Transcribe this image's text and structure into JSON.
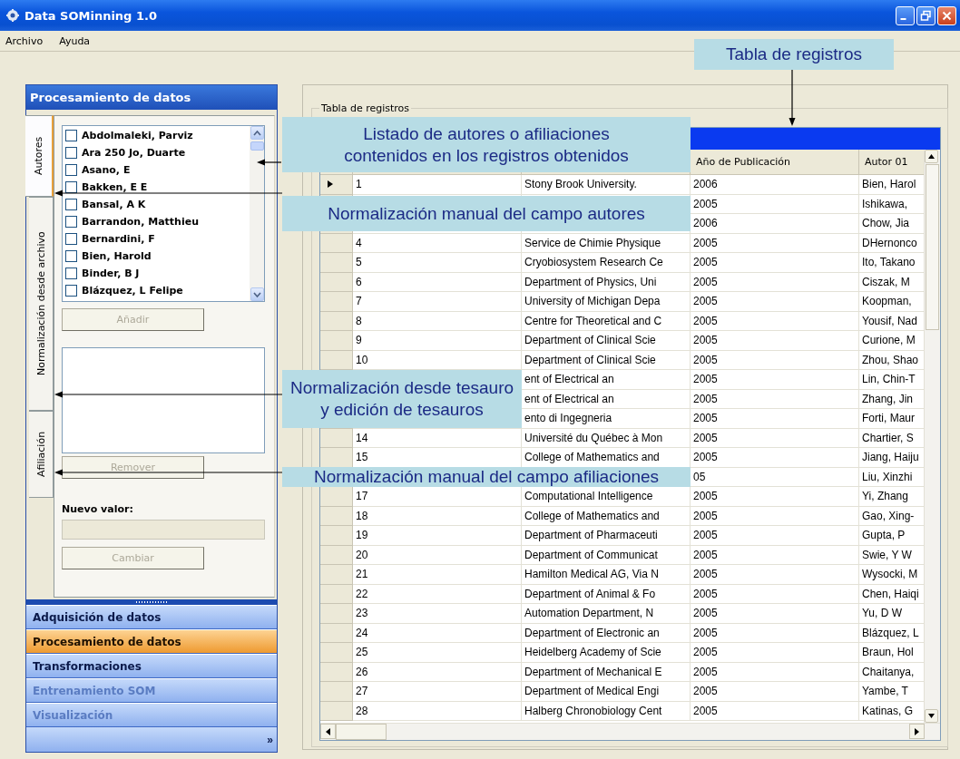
{
  "window": {
    "title": "Data SOMinning 1.0"
  },
  "menu": [
    "Archivo",
    "Ayuda"
  ],
  "left_panel": {
    "title": "Procesamiento de datos",
    "tabs": [
      {
        "label": "Autores",
        "selected": true
      },
      {
        "label": "Normalización desde archivo",
        "selected": false
      },
      {
        "label": "Afiliación",
        "selected": false
      }
    ],
    "list": [
      {
        "label": "Abdolmaleki, Parviz",
        "checked": false
      },
      {
        "label": "Ara 250 Jo, Duarte",
        "checked": false
      },
      {
        "label": "Asano, E",
        "checked": false
      },
      {
        "label": "Bakken, E E",
        "checked": false
      },
      {
        "label": "Bansal, A K",
        "checked": false
      },
      {
        "label": "Barrandon, Matthieu",
        "checked": false
      },
      {
        "label": "Bernardini, F",
        "checked": false
      },
      {
        "label": "Bien, Harold",
        "checked": false
      },
      {
        "label": "Binder, B J",
        "checked": false
      },
      {
        "label": "Blázquez, L Felipe",
        "checked": false
      }
    ],
    "add_button": {
      "label": "Añadir",
      "disabled": true
    },
    "remove_button": {
      "label": "Remover",
      "disabled": true
    },
    "new_value_label": "Nuevo valor:",
    "new_value_field": {
      "disabled": true
    },
    "change_button": {
      "label": "Cambiar",
      "disabled": true
    }
  },
  "nav": [
    {
      "label": "Adquisición de datos",
      "selected": false,
      "disabled": false
    },
    {
      "label": "Procesamiento de datos",
      "selected": true,
      "disabled": false
    },
    {
      "label": "Transformaciones",
      "selected": false,
      "disabled": false
    },
    {
      "label": "Entrenamiento SOM",
      "selected": false,
      "disabled": true
    },
    {
      "label": "Visualización",
      "selected": false,
      "disabled": true
    }
  ],
  "nav_more": "»",
  "records": {
    "legend": "Tabla de registros",
    "headers": {
      "year": "Año de Publicación",
      "author": "Autor 01"
    },
    "rows": [
      {
        "number": "1",
        "affiliation": "Stony Brook University.",
        "year": "2006",
        "author": "Bien, Harol",
        "current": true
      },
      {
        "year": "2005",
        "author": "Ishikawa,"
      },
      {
        "year": "2006",
        "author": "Chow, Jia"
      },
      {
        "number": "4",
        "affiliation": "Service de Chimie Physique",
        "year": "2005",
        "author": "DHernonco",
        "current": false
      },
      {
        "number": "5",
        "affiliation": "Cryobiosystem Research Ce",
        "year": "2005",
        "author": "Ito, Takano",
        "current": false
      },
      {
        "number": "6",
        "affiliation": "Department of Physics, Uni",
        "year": "2005",
        "author": "Ciszak, M",
        "current": false
      },
      {
        "number": "7",
        "affiliation": "University of Michigan Depa",
        "year": "2005",
        "author": "Koopman,",
        "current": false
      },
      {
        "number": "8",
        "affiliation": "Centre for Theoretical and C",
        "year": "2005",
        "author": "Yousif, Nad",
        "current": false
      },
      {
        "number": "9",
        "affiliation": "Department of Clinical Scie",
        "year": "2005",
        "author": "Curione, M",
        "current": false
      },
      {
        "number": "10",
        "affiliation": "Department of Clinical Scie",
        "year": "2005",
        "author": "Zhou, Shao",
        "current": false
      },
      {
        "affiliation": "ent of Electrical an",
        "year": "2005",
        "author": "Lin, Chin-T"
      },
      {
        "affiliation": "ent of Electrical an",
        "year": "2005",
        "author": "Zhang, Jin"
      },
      {
        "affiliation": "ento di Ingegneria",
        "year": "2005",
        "author": "Forti, Maur"
      },
      {
        "number": "14",
        "affiliation": "Université du Québec à Mon",
        "year": "2005",
        "author": "Chartier, S",
        "current": false
      },
      {
        "number": "15",
        "affiliation": "College of Mathematics and",
        "year": "2005",
        "author": "Jiang, Haiju",
        "current": false
      },
      {
        "year": "05",
        "author": "Liu, Xinzhi"
      },
      {
        "number": "17",
        "affiliation": "Computational Intelligence",
        "year": "2005",
        "author": "Yi, Zhang",
        "current": false
      },
      {
        "number": "18",
        "affiliation": "College of Mathematics and",
        "year": "2005",
        "author": "Gao, Xing-",
        "current": false
      },
      {
        "number": "19",
        "affiliation": "Department of Pharmaceuti",
        "year": "2005",
        "author": "Gupta, P",
        "current": false
      },
      {
        "number": "20",
        "affiliation": "Department of Communicat",
        "year": "2005",
        "author": "Swie, Y W",
        "current": false
      },
      {
        "number": "21",
        "affiliation": "Hamilton Medical AG, Via N",
        "year": "2005",
        "author": "Wysocki, M",
        "current": false
      },
      {
        "number": "22",
        "affiliation": "Department of Animal & Fo",
        "year": "2005",
        "author": "Chen, Haiqi",
        "current": false
      },
      {
        "number": "23",
        "affiliation": "Automation Department, N",
        "year": "2005",
        "author": "Yu, D W",
        "current": false
      },
      {
        "number": "24",
        "affiliation": "Department of Electronic an",
        "year": "2005",
        "author": "Blázquez, L",
        "current": false
      },
      {
        "number": "25",
        "affiliation": "Heidelberg Academy of Scie",
        "year": "2005",
        "author": "Braun, Hol",
        "current": false
      },
      {
        "number": "26",
        "affiliation": "Department of Mechanical E",
        "year": "2005",
        "author": "Chaitanya,",
        "current": false
      },
      {
        "number": "27",
        "affiliation": "Department of Medical Engi",
        "year": "2005",
        "author": "Yambe, T",
        "current": false
      },
      {
        "number": "28",
        "affiliation": "Halberg Chronobiology Cent",
        "year": "2005",
        "author": "Katinas, G",
        "current": false
      }
    ]
  },
  "callouts": [
    {
      "lines": [
        "Tabla de registros"
      ]
    },
    {
      "lines": [
        "Listado de autores o afiliaciones",
        "contenidos en los registros obtenidos"
      ]
    },
    {
      "lines": [
        "Normalización manual del campo autores"
      ]
    },
    {
      "lines": [
        "Normalización desde tesauro",
        "y edición de tesauros"
      ]
    },
    {
      "lines": [
        "Normalización manual del campo afiliaciones"
      ]
    }
  ]
}
